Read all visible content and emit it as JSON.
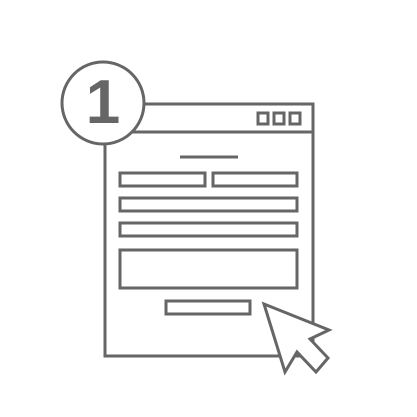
{
  "step": {
    "number": "1"
  },
  "icons": {
    "window": "browser-window-icon",
    "form": "form-icon",
    "cursor": "mouse-pointer-icon",
    "badge": "step-number-badge"
  },
  "colors": {
    "stroke": "#666666",
    "background": "#ffffff"
  }
}
